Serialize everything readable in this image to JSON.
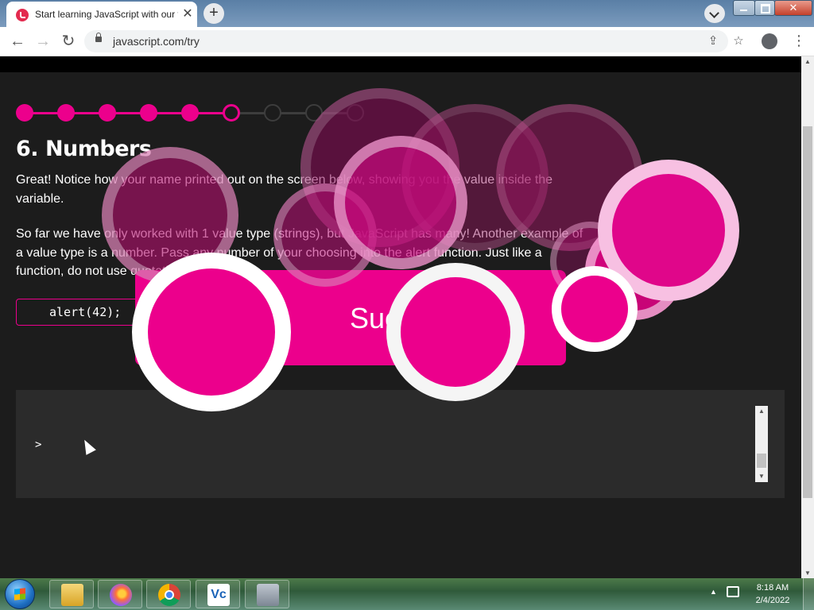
{
  "browser": {
    "tab_title": "Start learning JavaScript with our free tutorial",
    "tab_close": "✕",
    "new_tab": "+",
    "url": "javascript.com/try",
    "back": "←",
    "forward": "→",
    "reload": "↻",
    "share": "⇪",
    "bookmark": "☆",
    "menu": "⋮",
    "window_close": "✕"
  },
  "lesson": {
    "title": "6. Numbers",
    "paragraph1": "Great! Notice how your name printed out on the screen below, showing you the value inside the variable.",
    "paragraph2": "So far we have only worked with 1 value type (strings), but JavaScript has many! Another example of a value type is a number. Pass any number of your choosing into the alert function. Just like a function, do not use quotation marks.",
    "code": "alert(42);",
    "success_label": "Suc",
    "progress": {
      "total": 9,
      "completed": 5,
      "current": 6
    },
    "accent_color": "#ec008c"
  },
  "console": {
    "prompt": ">"
  },
  "taskbar": {
    "time": "8:18 AM",
    "date": "2/4/2022",
    "vc_label": "Vc",
    "tray_arrow": "▲"
  }
}
